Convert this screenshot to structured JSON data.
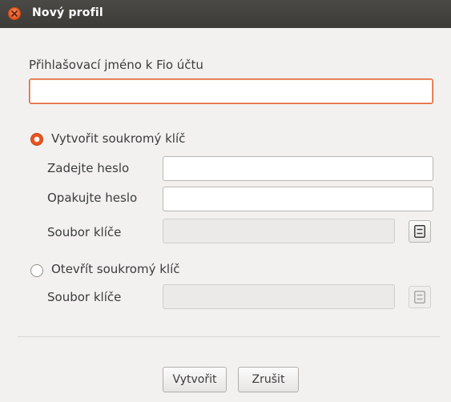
{
  "window": {
    "title": "Nový profil"
  },
  "form": {
    "login_label": "Přihlašovací jméno k Fio účtu",
    "login_value": "",
    "create_key": {
      "label": "Vytvořit soukromý klíč",
      "selected": true,
      "password_label": "Zadejte heslo",
      "password_value": "",
      "repeat_label": "Opakujte heslo",
      "repeat_value": "",
      "keyfile_label": "Soubor klíče",
      "keyfile_value": ""
    },
    "open_key": {
      "label": "Otevřít soukromý klíč",
      "selected": false,
      "keyfile_label": "Soubor klíče",
      "keyfile_value": ""
    }
  },
  "buttons": {
    "create_label": "Vytvořit",
    "cancel_label": "Zrušit"
  },
  "icons": {
    "close": "close-icon",
    "file_chooser": "file-cabinet-icon"
  },
  "colors": {
    "accent": "#e95420",
    "titlebar": "#3c3b37"
  }
}
